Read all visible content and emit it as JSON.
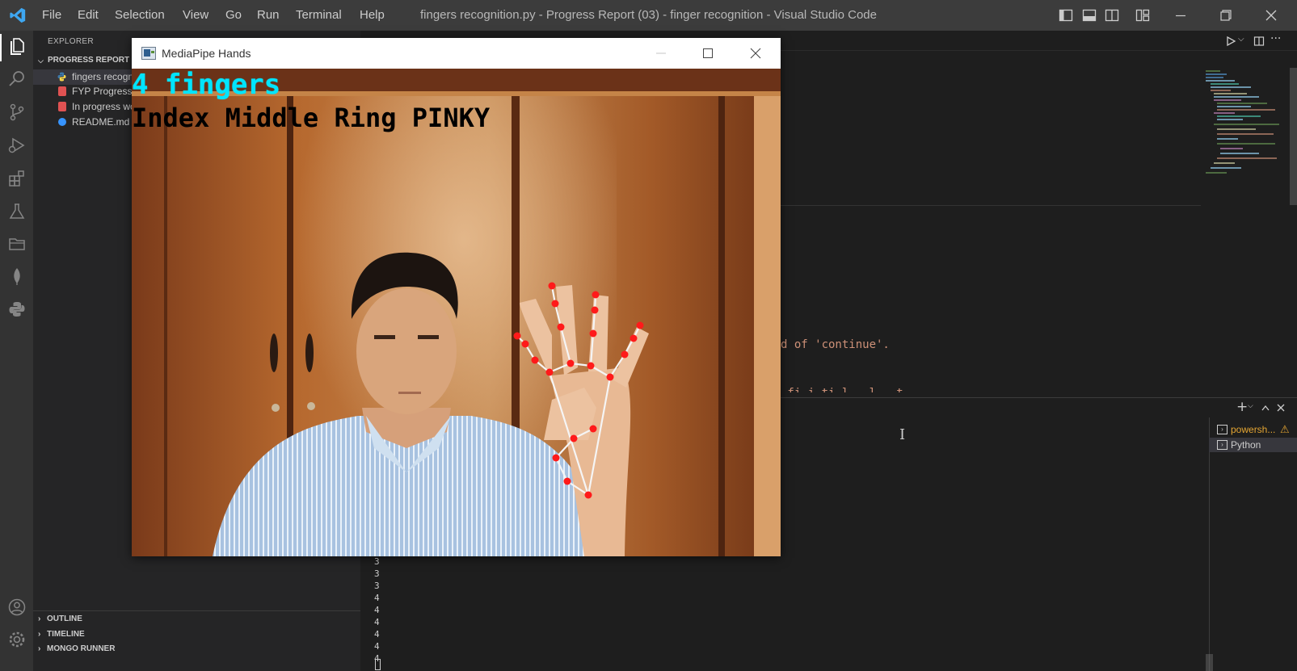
{
  "app": {
    "menu": [
      "File",
      "Edit",
      "Selection",
      "View",
      "Go",
      "Run",
      "Terminal",
      "Help"
    ],
    "window_title": "fingers recognition.py - Progress Report (03) - finger recognition - Visual Studio Code"
  },
  "sidebar": {
    "header": "EXPLORER",
    "folder": "PROGRESS REPORT (03)",
    "files": [
      {
        "label": "fingers recogni",
        "icon": "python-file-icon"
      },
      {
        "label": "FYP Progress  R",
        "icon": "pdf-file-icon"
      },
      {
        "label": "In progress wo",
        "icon": "pdf-file-icon"
      },
      {
        "label": "README.md",
        "icon": "info-file-icon"
      }
    ],
    "sections": [
      "OUTLINE",
      "TIMELINE",
      "MONGO RUNNER"
    ]
  },
  "editor": {
    "code_fragment_1": "d of 'continue'.",
    "code_fragment_2": "-fi  i   ti l    -  l   -   t"
  },
  "terminal": {
    "tabs": [
      "powersh...",
      "Python"
    ],
    "output": [
      "3",
      "3",
      "3",
      "4",
      "4",
      "4",
      "4",
      "4",
      "4"
    ]
  },
  "mediapipe": {
    "window_title": "MediaPipe Hands",
    "overlay_count": "4 fingers",
    "overlay_names": "Index Middle Ring PINKY"
  },
  "colors": {
    "overlay_count": "#00e5ff",
    "landmark": "#ff1a1a",
    "accent": "#007acc"
  }
}
